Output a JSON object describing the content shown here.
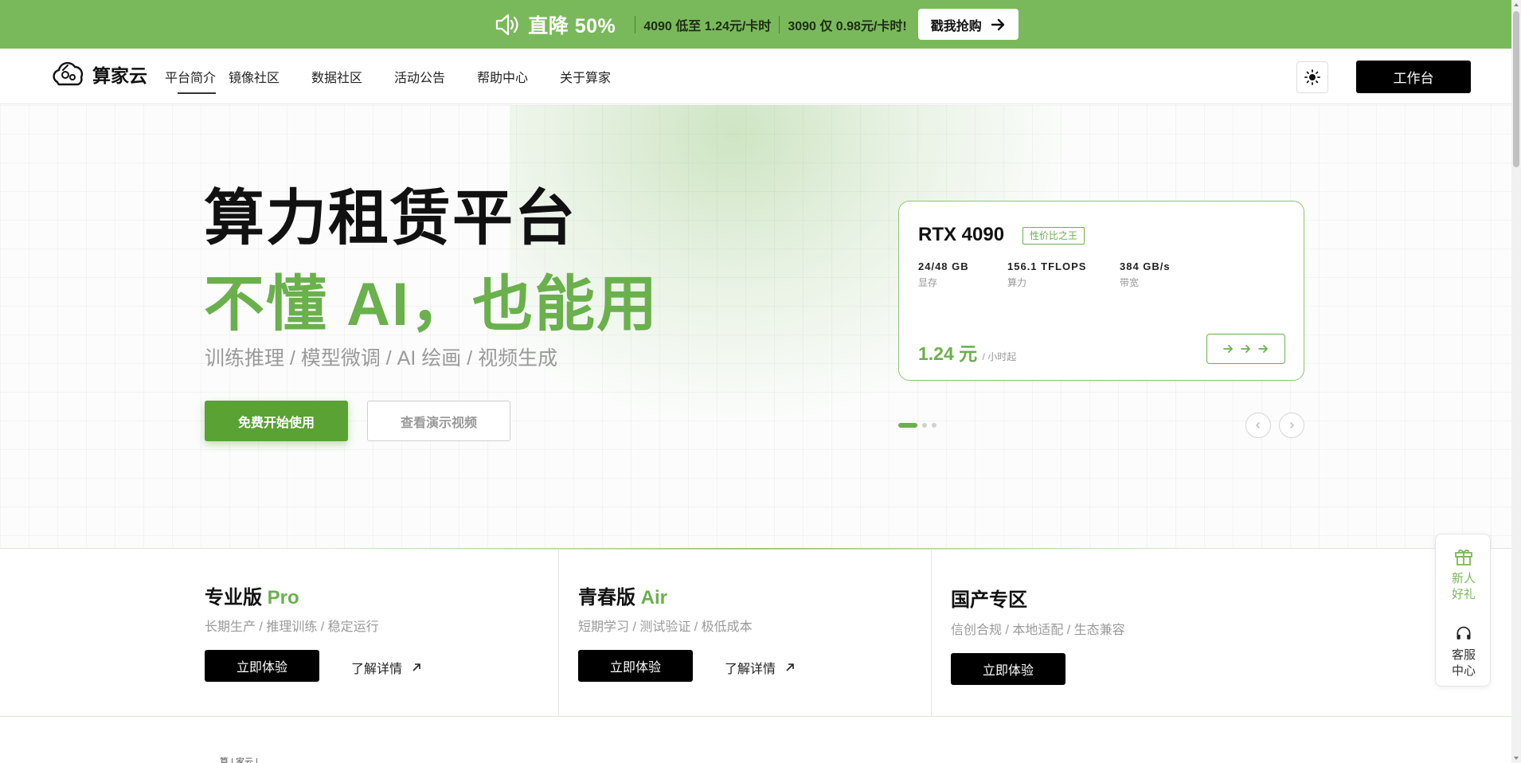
{
  "promo": {
    "headline": "直降 50%",
    "offer1": "4090 低至 1.24元/卡时",
    "offer2": "3090 仅 0.98元/卡时!",
    "cta": "戳我抢购"
  },
  "nav": {
    "brand": "算家云",
    "items": [
      "平台简介",
      "镜像社区",
      "数据社区",
      "活动公告",
      "帮助中心",
      "关于算家"
    ],
    "workbench": "工作台"
  },
  "hero": {
    "title": "算力租赁平台",
    "subtitle": "不懂 AI，也能用",
    "tagline": "训练推理 / 模型微调 / AI 绘画 / 视频生成",
    "primary_cta": "免费开始使用",
    "secondary_cta": "查看演示视频"
  },
  "gpu_card": {
    "name": "RTX 4090",
    "tag": "性价比之王",
    "specs": [
      {
        "value": "24/48 GB",
        "label": "显存"
      },
      {
        "value": "156.1 TFLOPS",
        "label": "算力"
      },
      {
        "value": "384 GB/s",
        "label": "带宽"
      }
    ],
    "price": "1.24 元",
    "price_unit": "/ 小时起"
  },
  "carousel": {
    "active_index": 0,
    "total": 3
  },
  "products": [
    {
      "name": "专业版",
      "accent": "Pro",
      "desc": "长期生产 / 推理训练 / 稳定运行",
      "try": "立即体验",
      "more": "了解详情"
    },
    {
      "name": "青春版",
      "accent": "Air",
      "desc": "短期学习 / 测试验证 / 极低成本",
      "try": "立即体验",
      "more": "了解详情"
    },
    {
      "name": "国产专区",
      "accent": "",
      "desc": "信创合规 / 本地适配 / 生态兼容",
      "try": "立即体验"
    }
  ],
  "below_text": "算 | 家云 |",
  "side": {
    "gift": "新人\n好礼",
    "gift_line1": "新人",
    "gift_line2": "好礼",
    "service_line1": "客服",
    "service_line2": "中心"
  },
  "colors": {
    "accent": "#6ab04c",
    "banner": "#7ab95b",
    "primary_button": "#5aa234",
    "dark_button": "#000000"
  },
  "icons": [
    "speaker-icon",
    "arrow-right-icon",
    "logo-icon",
    "sun-icon",
    "chevron-left-icon",
    "chevron-right-icon",
    "arrow-up-right-icon",
    "gift-icon",
    "headset-icon"
  ]
}
